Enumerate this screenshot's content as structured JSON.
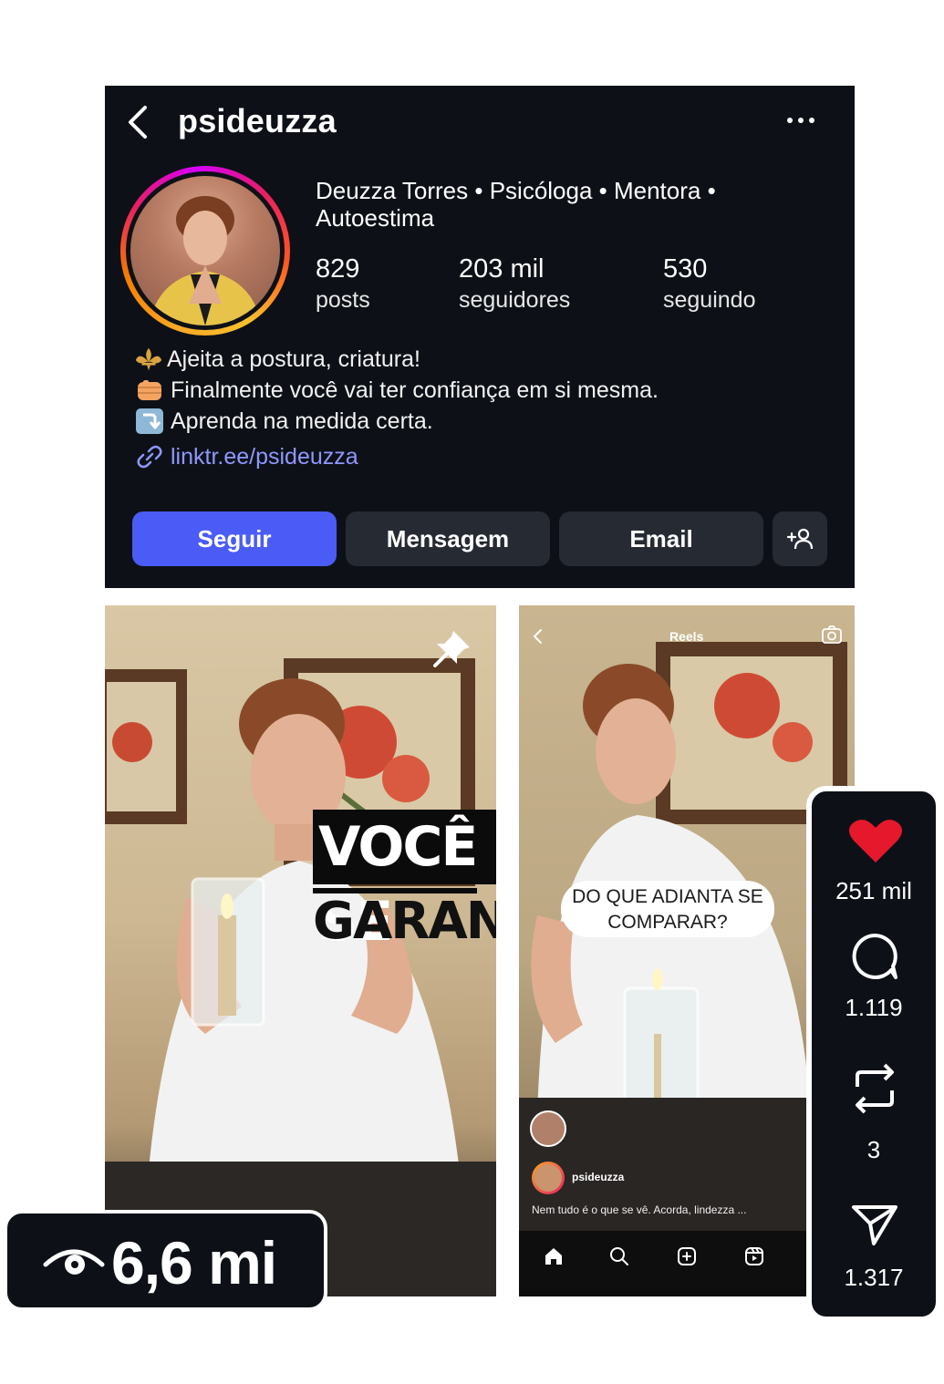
{
  "profile": {
    "username": "psideuzza",
    "full_name": "Deuzza Torres • Psicóloga • Mentora • Autoestima",
    "stats": {
      "posts_value": "829",
      "posts_label": "posts",
      "followers_value": "203 mil",
      "followers_label": "seguidores",
      "following_value": "530",
      "following_label": "seguindo"
    },
    "bio": [
      "Ajeita a postura, criatura!",
      "Finalmente você vai ter confiança em si mesma.",
      "Aprenda na medida certa."
    ],
    "link": "linktr.ee/psideuzza",
    "buttons": {
      "follow": "Seguir",
      "message": "Mensagem",
      "email": "Email"
    }
  },
  "post_left": {
    "caption_line1": "VOCÊ SE",
    "caption_line2": "GARANTE.",
    "icon": "pin-icon"
  },
  "post_right": {
    "header_title": "Reels",
    "speech_text": "DO QUE ADIANTA SE COMPARAR?",
    "username": "psideuzza",
    "caption": "Nem tudo é o que se vê. Acorda, lindezza ..."
  },
  "views": {
    "value": "6,6 mi"
  },
  "actions": {
    "likes": "251 mil",
    "comments": "1.119",
    "reposts": "3",
    "shares": "1.317"
  },
  "colors": {
    "profile_bg": "#0d1117",
    "follow_button": "#4a5cf5",
    "secondary_button": "#262b33",
    "link": "#8f97ff",
    "like_heart": "#e5192b"
  }
}
